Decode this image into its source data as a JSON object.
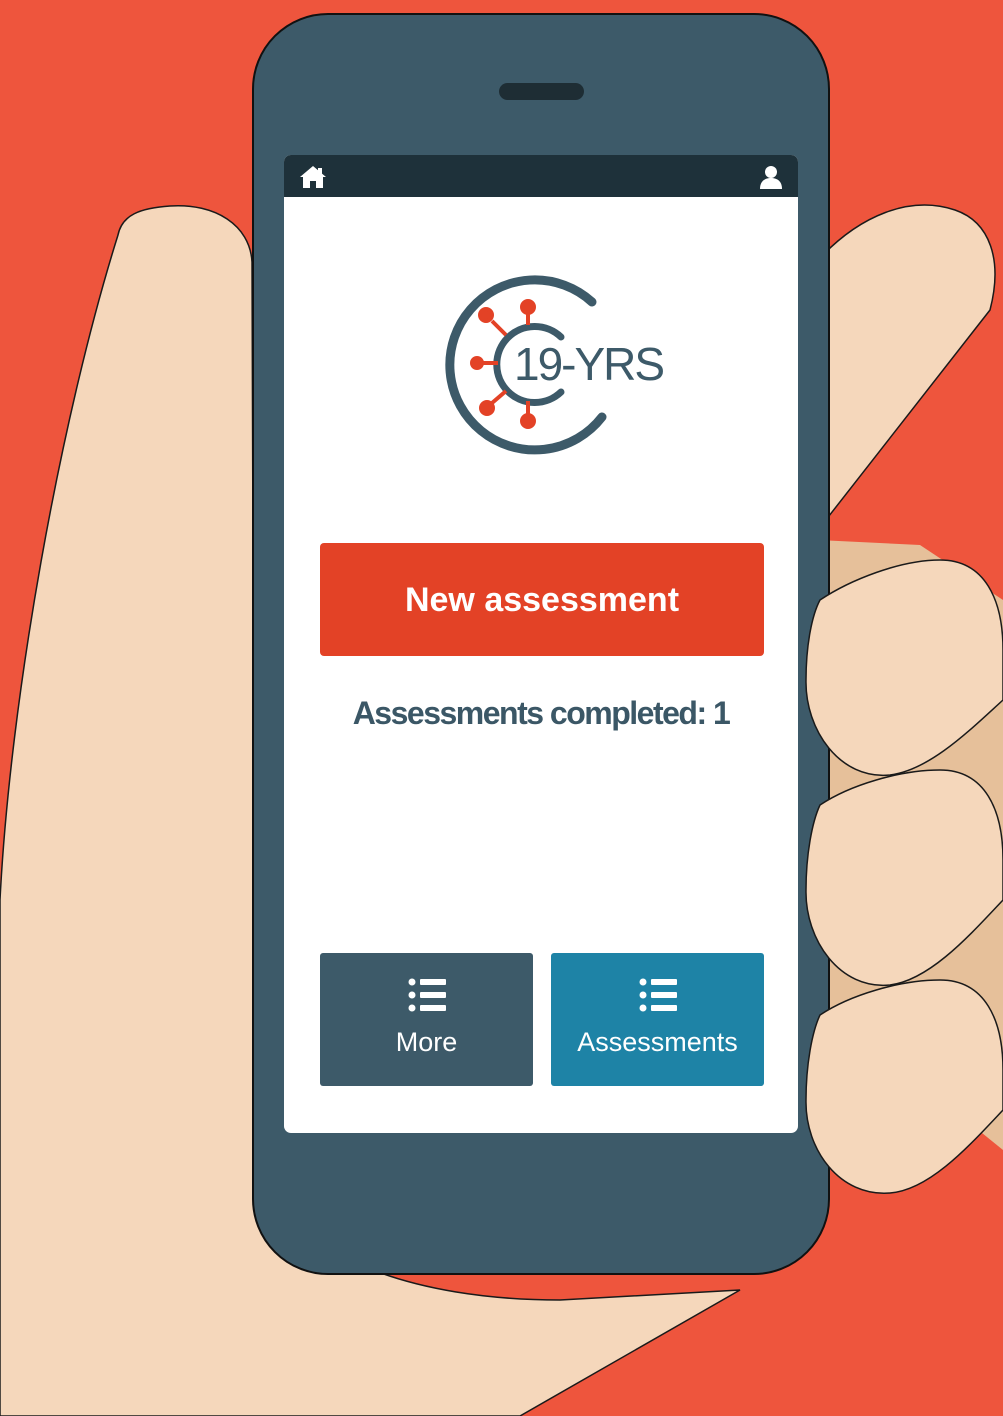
{
  "app": {
    "logo_text": "19-YRS",
    "new_assessment_label": "New assessment",
    "completed_label": "Assessments completed:",
    "completed_count": "1"
  },
  "topbar": {
    "home_icon": "home-icon",
    "profile_icon": "user-icon"
  },
  "nav": {
    "more_label": "More",
    "assessments_label": "Assessments",
    "icon": "list-icon"
  },
  "colors": {
    "background": "#ee553d",
    "phone_body": "#3d5a69",
    "status_bar": "#1e313a",
    "primary_button": "#e34226",
    "more_tile": "#3d5a69",
    "assessments_tile": "#1e83a6",
    "text": "#3b5766"
  }
}
